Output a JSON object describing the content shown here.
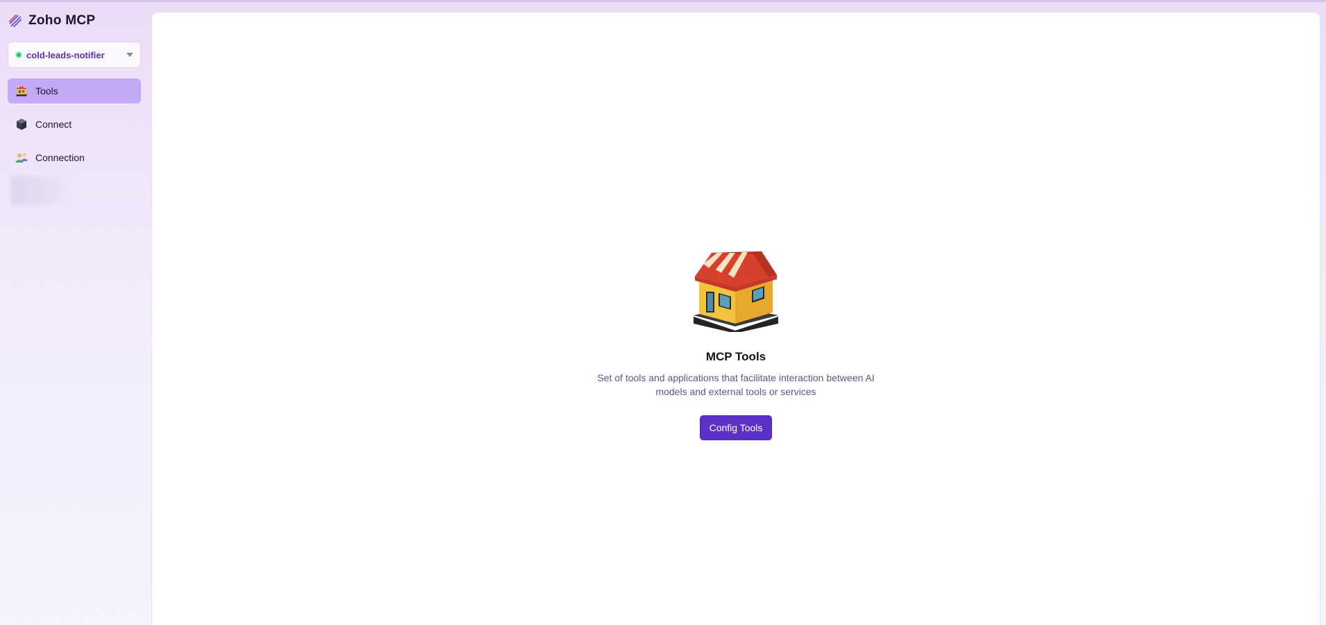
{
  "sidebar": {
    "brand": {
      "name": "Zoho MCP",
      "icon": "zoho-mcp-logo-icon"
    },
    "workspace": {
      "name": "cold-leads-notifier",
      "status_color": "#24c16b"
    },
    "nav": [
      {
        "label": "Tools",
        "icon": "store-icon",
        "active": true
      },
      {
        "label": "Connect",
        "icon": "cube-icon",
        "active": false
      },
      {
        "label": "Connection",
        "icon": "users-icon",
        "active": false
      }
    ]
  },
  "main": {
    "empty_state": {
      "illustration": "store-illustration-icon",
      "title": "MCP Tools",
      "description": "Set of tools and applications that facilitate interaction between AI models and external tools or services",
      "button_label": "Config Tools"
    }
  },
  "colors": {
    "accent": "#5b32c8",
    "active_nav": "#c4aaf6"
  }
}
